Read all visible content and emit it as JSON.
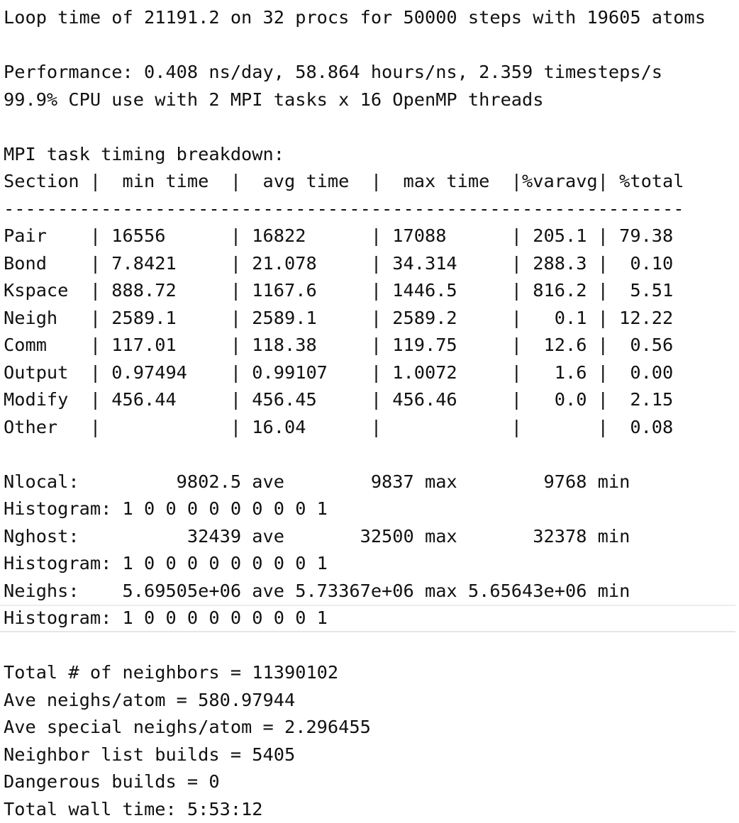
{
  "log": {
    "lines": [
      "Loop time of 21191.2 on 32 procs for 50000 steps with 19605 atoms",
      "",
      "Performance: 0.408 ns/day, 58.864 hours/ns, 2.359 timesteps/s",
      "99.9% CPU use with 2 MPI tasks x 16 OpenMP threads",
      "",
      "MPI task timing breakdown:",
      "Section |  min time  |  avg time  |  max time  |%varavg| %total",
      "---------------------------------------------------------------",
      "Pair    | 16556      | 16822      | 17088      | 205.1 | 79.38",
      "Bond    | 7.8421     | 21.078     | 34.314     | 288.3 |  0.10",
      "Kspace  | 888.72     | 1167.6     | 1446.5     | 816.2 |  5.51",
      "Neigh   | 2589.1     | 2589.1     | 2589.2     |   0.1 | 12.22",
      "Comm    | 117.01     | 118.38     | 119.75     |  12.6 |  0.56",
      "Output  | 0.97494    | 0.99107    | 1.0072     |   1.6 |  0.00",
      "Modify  | 456.44     | 456.45     | 456.46     |   0.0 |  2.15",
      "Other   |            | 16.04      |            |       |  0.08",
      "",
      "Nlocal:         9802.5 ave        9837 max        9768 min",
      "Histogram: 1 0 0 0 0 0 0 0 0 1",
      "Nghost:          32439 ave       32500 max       32378 min",
      "Histogram: 1 0 0 0 0 0 0 0 0 1",
      "Neighs:    5.69505e+06 ave 5.73367e+06 max 5.65643e+06 min",
      "Histogram: 1 0 0 0 0 0 0 0 0 1",
      "",
      "Total # of neighbors = 11390102",
      "Ave neighs/atom = 580.97944",
      "Ave special neighs/atom = 2.296455",
      "Neighbor list builds = 5405",
      "Dangerous builds = 0",
      "Total wall time: 5:53:12"
    ]
  }
}
